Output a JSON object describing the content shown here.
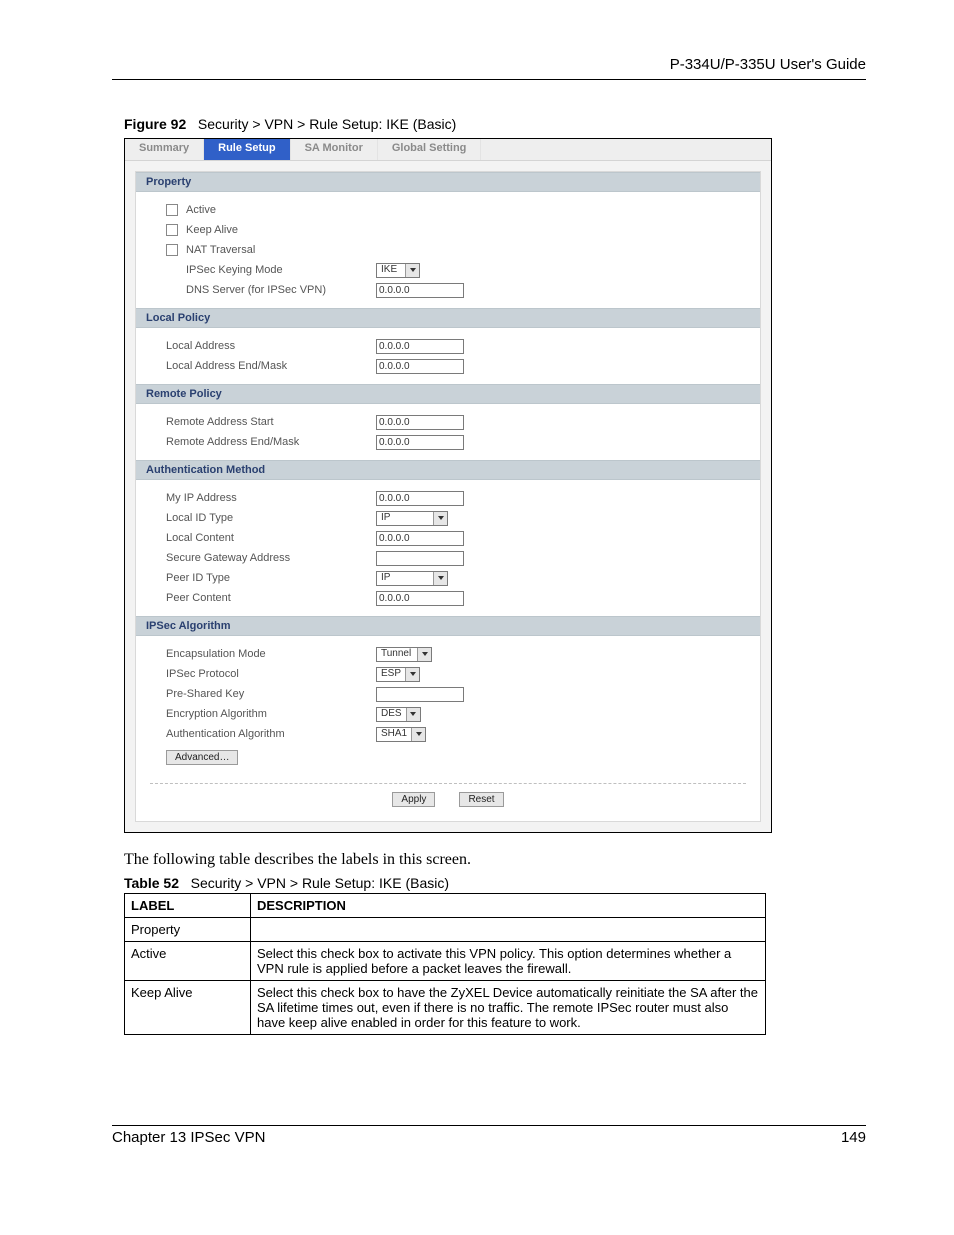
{
  "header": {
    "guide": "P-334U/P-335U User's Guide"
  },
  "figure": {
    "label": "Figure 92",
    "title": "Security > VPN > Rule Setup: IKE (Basic)"
  },
  "tabs": [
    "Summary",
    "Rule Setup",
    "SA Monitor",
    "Global Setting"
  ],
  "sections": {
    "property": {
      "title": "Property",
      "active": "Active",
      "keep_alive": "Keep Alive",
      "nat_traversal": "NAT Traversal",
      "ipsec_keying_mode": "IPSec Keying Mode",
      "ipsec_keying_mode_val": "IKE",
      "dns_server": "DNS Server (for IPSec VPN)",
      "dns_server_val": "0.0.0.0"
    },
    "local_policy": {
      "title": "Local Policy",
      "local_address": "Local Address",
      "local_address_val": "0.0.0.0",
      "local_end": "Local Address End/Mask",
      "local_end_val": "0.0.0.0"
    },
    "remote_policy": {
      "title": "Remote Policy",
      "remote_start": "Remote Address Start",
      "remote_start_val": "0.0.0.0",
      "remote_end": "Remote Address End/Mask",
      "remote_end_val": "0.0.0.0"
    },
    "auth_method": {
      "title": "Authentication Method",
      "my_ip": "My IP Address",
      "my_ip_val": "0.0.0.0",
      "local_id_type": "Local ID Type",
      "local_id_type_val": "IP",
      "local_content": "Local Content",
      "local_content_val": "0.0.0.0",
      "secure_gw": "Secure Gateway Address",
      "secure_gw_val": "",
      "peer_id_type": "Peer ID Type",
      "peer_id_type_val": "IP",
      "peer_content": "Peer Content",
      "peer_content_val": "0.0.0.0"
    },
    "ipsec_algo": {
      "title": "IPSec Algorithm",
      "encap_mode": "Encapsulation Mode",
      "encap_mode_val": "Tunnel",
      "ipsec_proto": "IPSec Protocol",
      "ipsec_proto_val": "ESP",
      "psk": "Pre-Shared Key",
      "psk_val": "",
      "enc_algo": "Encryption Algorithm",
      "enc_algo_val": "DES",
      "auth_algo": "Authentication Algorithm",
      "auth_algo_val": "SHA1",
      "advanced": "Advanced…"
    }
  },
  "actions": {
    "apply": "Apply",
    "reset": "Reset"
  },
  "body_text": "The following table describes the labels in this screen.",
  "table": {
    "caption_label": "Table 52",
    "caption_title": "Security > VPN > Rule Setup: IKE (Basic)",
    "head_label": "LABEL",
    "head_desc": "DESCRIPTION",
    "rows": [
      {
        "label": "Property",
        "desc": ""
      },
      {
        "label": "Active",
        "desc": "Select this check box to activate this VPN policy. This option determines whether a VPN rule is applied before a packet leaves the firewall."
      },
      {
        "label": "Keep Alive",
        "desc": "Select this check box to have the ZyXEL Device automatically reinitiate the SA after the SA lifetime times out, even if there is no traffic. The remote IPSec router must also have keep alive enabled in order for this feature to work."
      }
    ]
  },
  "footer": {
    "chapter": "Chapter 13 IPSec VPN",
    "page": "149"
  }
}
